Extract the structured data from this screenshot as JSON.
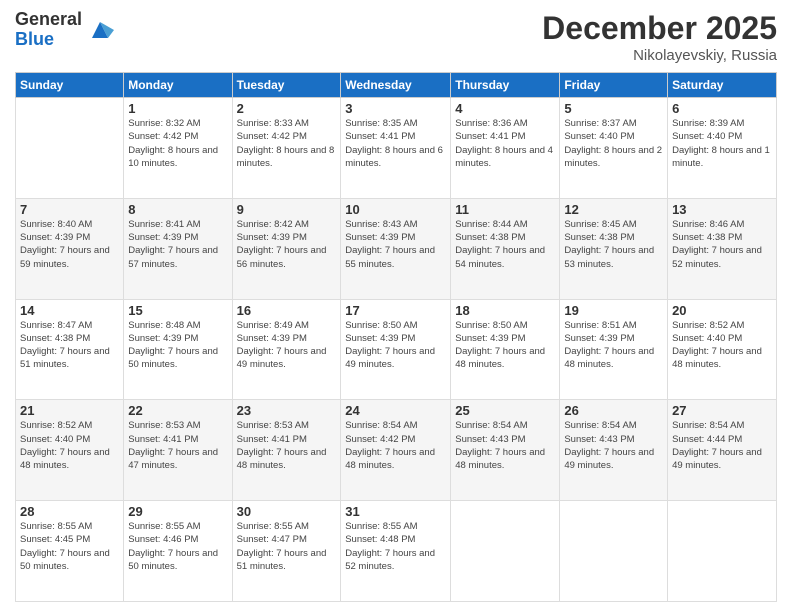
{
  "logo": {
    "general": "General",
    "blue": "Blue"
  },
  "header": {
    "month": "December 2025",
    "location": "Nikolayevskiy, Russia"
  },
  "weekdays": [
    "Sunday",
    "Monday",
    "Tuesday",
    "Wednesday",
    "Thursday",
    "Friday",
    "Saturday"
  ],
  "weeks": [
    [
      {
        "day": "",
        "sunrise": "",
        "sunset": "",
        "daylight": ""
      },
      {
        "day": "1",
        "sunrise": "Sunrise: 8:32 AM",
        "sunset": "Sunset: 4:42 PM",
        "daylight": "Daylight: 8 hours and 10 minutes."
      },
      {
        "day": "2",
        "sunrise": "Sunrise: 8:33 AM",
        "sunset": "Sunset: 4:42 PM",
        "daylight": "Daylight: 8 hours and 8 minutes."
      },
      {
        "day": "3",
        "sunrise": "Sunrise: 8:35 AM",
        "sunset": "Sunset: 4:41 PM",
        "daylight": "Daylight: 8 hours and 6 minutes."
      },
      {
        "day": "4",
        "sunrise": "Sunrise: 8:36 AM",
        "sunset": "Sunset: 4:41 PM",
        "daylight": "Daylight: 8 hours and 4 minutes."
      },
      {
        "day": "5",
        "sunrise": "Sunrise: 8:37 AM",
        "sunset": "Sunset: 4:40 PM",
        "daylight": "Daylight: 8 hours and 2 minutes."
      },
      {
        "day": "6",
        "sunrise": "Sunrise: 8:39 AM",
        "sunset": "Sunset: 4:40 PM",
        "daylight": "Daylight: 8 hours and 1 minute."
      }
    ],
    [
      {
        "day": "7",
        "sunrise": "Sunrise: 8:40 AM",
        "sunset": "Sunset: 4:39 PM",
        "daylight": "Daylight: 7 hours and 59 minutes."
      },
      {
        "day": "8",
        "sunrise": "Sunrise: 8:41 AM",
        "sunset": "Sunset: 4:39 PM",
        "daylight": "Daylight: 7 hours and 57 minutes."
      },
      {
        "day": "9",
        "sunrise": "Sunrise: 8:42 AM",
        "sunset": "Sunset: 4:39 PM",
        "daylight": "Daylight: 7 hours and 56 minutes."
      },
      {
        "day": "10",
        "sunrise": "Sunrise: 8:43 AM",
        "sunset": "Sunset: 4:39 PM",
        "daylight": "Daylight: 7 hours and 55 minutes."
      },
      {
        "day": "11",
        "sunrise": "Sunrise: 8:44 AM",
        "sunset": "Sunset: 4:38 PM",
        "daylight": "Daylight: 7 hours and 54 minutes."
      },
      {
        "day": "12",
        "sunrise": "Sunrise: 8:45 AM",
        "sunset": "Sunset: 4:38 PM",
        "daylight": "Daylight: 7 hours and 53 minutes."
      },
      {
        "day": "13",
        "sunrise": "Sunrise: 8:46 AM",
        "sunset": "Sunset: 4:38 PM",
        "daylight": "Daylight: 7 hours and 52 minutes."
      }
    ],
    [
      {
        "day": "14",
        "sunrise": "Sunrise: 8:47 AM",
        "sunset": "Sunset: 4:38 PM",
        "daylight": "Daylight: 7 hours and 51 minutes."
      },
      {
        "day": "15",
        "sunrise": "Sunrise: 8:48 AM",
        "sunset": "Sunset: 4:39 PM",
        "daylight": "Daylight: 7 hours and 50 minutes."
      },
      {
        "day": "16",
        "sunrise": "Sunrise: 8:49 AM",
        "sunset": "Sunset: 4:39 PM",
        "daylight": "Daylight: 7 hours and 49 minutes."
      },
      {
        "day": "17",
        "sunrise": "Sunrise: 8:50 AM",
        "sunset": "Sunset: 4:39 PM",
        "daylight": "Daylight: 7 hours and 49 minutes."
      },
      {
        "day": "18",
        "sunrise": "Sunrise: 8:50 AM",
        "sunset": "Sunset: 4:39 PM",
        "daylight": "Daylight: 7 hours and 48 minutes."
      },
      {
        "day": "19",
        "sunrise": "Sunrise: 8:51 AM",
        "sunset": "Sunset: 4:39 PM",
        "daylight": "Daylight: 7 hours and 48 minutes."
      },
      {
        "day": "20",
        "sunrise": "Sunrise: 8:52 AM",
        "sunset": "Sunset: 4:40 PM",
        "daylight": "Daylight: 7 hours and 48 minutes."
      }
    ],
    [
      {
        "day": "21",
        "sunrise": "Sunrise: 8:52 AM",
        "sunset": "Sunset: 4:40 PM",
        "daylight": "Daylight: 7 hours and 48 minutes."
      },
      {
        "day": "22",
        "sunrise": "Sunrise: 8:53 AM",
        "sunset": "Sunset: 4:41 PM",
        "daylight": "Daylight: 7 hours and 47 minutes."
      },
      {
        "day": "23",
        "sunrise": "Sunrise: 8:53 AM",
        "sunset": "Sunset: 4:41 PM",
        "daylight": "Daylight: 7 hours and 48 minutes."
      },
      {
        "day": "24",
        "sunrise": "Sunrise: 8:54 AM",
        "sunset": "Sunset: 4:42 PM",
        "daylight": "Daylight: 7 hours and 48 minutes."
      },
      {
        "day": "25",
        "sunrise": "Sunrise: 8:54 AM",
        "sunset": "Sunset: 4:43 PM",
        "daylight": "Daylight: 7 hours and 48 minutes."
      },
      {
        "day": "26",
        "sunrise": "Sunrise: 8:54 AM",
        "sunset": "Sunset: 4:43 PM",
        "daylight": "Daylight: 7 hours and 49 minutes."
      },
      {
        "day": "27",
        "sunrise": "Sunrise: 8:54 AM",
        "sunset": "Sunset: 4:44 PM",
        "daylight": "Daylight: 7 hours and 49 minutes."
      }
    ],
    [
      {
        "day": "28",
        "sunrise": "Sunrise: 8:55 AM",
        "sunset": "Sunset: 4:45 PM",
        "daylight": "Daylight: 7 hours and 50 minutes."
      },
      {
        "day": "29",
        "sunrise": "Sunrise: 8:55 AM",
        "sunset": "Sunset: 4:46 PM",
        "daylight": "Daylight: 7 hours and 50 minutes."
      },
      {
        "day": "30",
        "sunrise": "Sunrise: 8:55 AM",
        "sunset": "Sunset: 4:47 PM",
        "daylight": "Daylight: 7 hours and 51 minutes."
      },
      {
        "day": "31",
        "sunrise": "Sunrise: 8:55 AM",
        "sunset": "Sunset: 4:48 PM",
        "daylight": "Daylight: 7 hours and 52 minutes."
      },
      {
        "day": "",
        "sunrise": "",
        "sunset": "",
        "daylight": ""
      },
      {
        "day": "",
        "sunrise": "",
        "sunset": "",
        "daylight": ""
      },
      {
        "day": "",
        "sunrise": "",
        "sunset": "",
        "daylight": ""
      }
    ]
  ]
}
